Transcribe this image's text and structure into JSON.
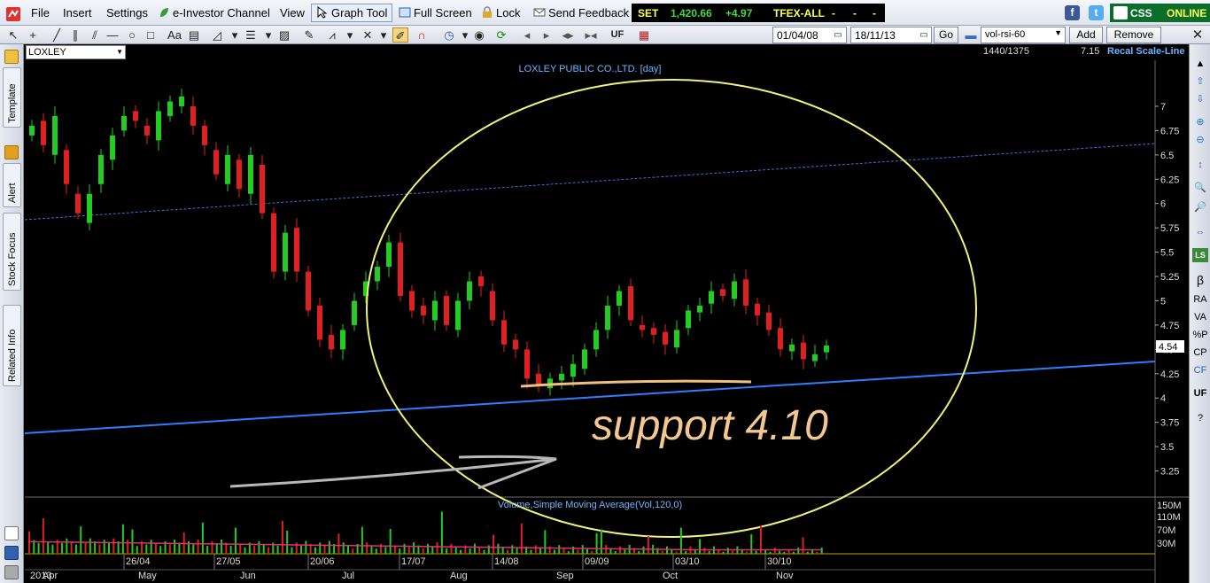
{
  "menu": {
    "file": "File",
    "insert": "Insert",
    "settings": "Settings",
    "investor_channel": "e-Investor Channel",
    "view": "View",
    "graph_tool": "Graph Tool",
    "full_screen": "Full Screen",
    "lock": "Lock",
    "send_feedback": "Send Feedback"
  },
  "ticker": {
    "index_name": "SET",
    "index_value": "1,420.66",
    "change": "+4.97",
    "futures": "TFEX-ALL",
    "dash1": "-",
    "dash2": "-",
    "dash3": "-"
  },
  "status": {
    "brand": "CSS",
    "connection": "ONLINE"
  },
  "toolbar": {
    "uf_label": "UF",
    "date_from": "01/04/08",
    "date_to": "18/11/13",
    "go_label": "Go",
    "indicator": "vol-rsi-60",
    "add_label": "Add",
    "remove_label": "Remove"
  },
  "subbar": {
    "symbol": "LOXLEY",
    "bar_count": "1440/1375",
    "cursor_value": "7.15",
    "recal_label": "Recal Scale-Line"
  },
  "left_tabs": [
    "Template",
    "Alert",
    "Stock Focus",
    "Related Info"
  ],
  "right_tools": [
    "β",
    "RA",
    "VA",
    "%P",
    "CP",
    "CF",
    "UF"
  ],
  "chart_data": {
    "type": "candlestick",
    "title": "LOXLEY PUBLIC CO.,LTD. [day]",
    "ylim": [
      3.1,
      7.2
    ],
    "y_ticks": [
      "7",
      "6.75",
      "6.5",
      "6.25",
      "6",
      "5.75",
      "5.5",
      "5.25",
      "5",
      "4.75",
      "4.5",
      "4.25",
      "4",
      "3.75",
      "3.5",
      "3.25"
    ],
    "last_price": "4.54",
    "annotation": "support 4.10",
    "date_labels": [
      "26/04",
      "27/05",
      "20/06",
      "17/07",
      "14/08",
      "09/09",
      "03/10",
      "30/10"
    ],
    "month_labels": [
      "2013",
      "Apr",
      "May",
      "Jun",
      "Jul",
      "Aug",
      "Sep",
      "Oct",
      "Nov"
    ],
    "closes": [
      6.8,
      6.6,
      6.9,
      6.2,
      5.9,
      6.1,
      6.5,
      6.7,
      6.9,
      6.85,
      6.7,
      6.95,
      7.05,
      7.1,
      6.8,
      6.6,
      6.3,
      6.5,
      6.15,
      6.5,
      5.9,
      5.3,
      5.7,
      5.3,
      4.9,
      4.6,
      4.5,
      4.7,
      5.0,
      5.2,
      5.35,
      5.6,
      5.05,
      4.9,
      4.85,
      5.0,
      4.75,
      5.0,
      5.2,
      5.15,
      4.8,
      4.55,
      4.5,
      4.2,
      4.12,
      4.2,
      4.25,
      4.35,
      4.5,
      4.7,
      4.95,
      5.1,
      4.8,
      4.7,
      4.65,
      4.55,
      4.7,
      4.9,
      4.95,
      5.1,
      5.05,
      5.2,
      4.95,
      4.85,
      4.7,
      4.5,
      4.55,
      4.4,
      4.45,
      4.54
    ],
    "opens": [
      6.7,
      6.85,
      6.5,
      6.55,
      6.1,
      5.8,
      6.2,
      6.45,
      6.75,
      6.95,
      6.8,
      6.65,
      6.9,
      7.0,
      7.0,
      6.8,
      6.55,
      6.2,
      6.45,
      6.1,
      6.4,
      5.9,
      5.3,
      5.75,
      5.3,
      4.95,
      4.65,
      4.5,
      4.75,
      5.05,
      5.2,
      5.35,
      5.6,
      5.1,
      4.95,
      4.8,
      5.05,
      4.7,
      5.0,
      5.25,
      5.1,
      4.8,
      4.6,
      4.5,
      4.25,
      4.1,
      4.18,
      4.22,
      4.3,
      4.5,
      4.7,
      4.95,
      5.15,
      4.75,
      4.72,
      4.68,
      4.52,
      4.72,
      4.88,
      4.97,
      5.12,
      5.02,
      5.22,
      4.97,
      4.88,
      4.72,
      4.48,
      4.57,
      4.38,
      4.47
    ],
    "volume_title": "Volume,Simple Moving Average(Vol,120,0)",
    "volume_ticks": [
      "150M",
      "110M",
      "70M",
      "30M"
    ]
  }
}
